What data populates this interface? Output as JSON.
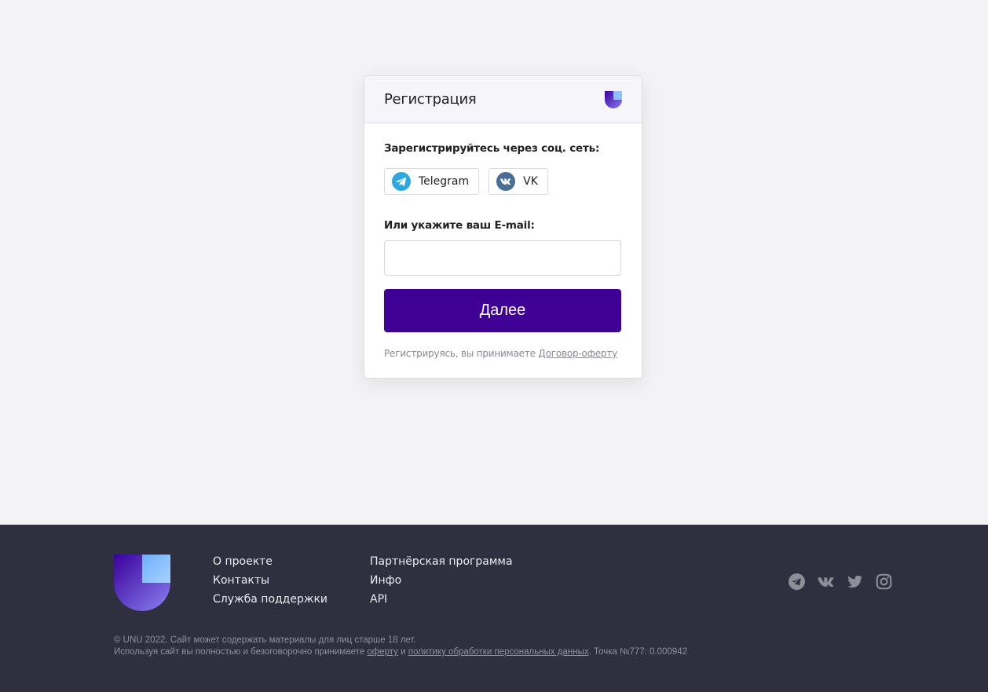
{
  "card": {
    "title": "Регистрация",
    "logo_icon": "unu-logo-icon",
    "social_label": "Зарегистрируйтесь через соц. сеть:",
    "telegram_label": "Telegram",
    "vk_label": "VK",
    "email_label": "Или укажите ваш E-mail:",
    "email_value": "",
    "email_placeholder": "",
    "submit_label": "Далее",
    "terms_text": "Регистрируясь, вы принимаете ",
    "terms_link": "Договор-оферту"
  },
  "footer": {
    "links_col1": [
      "О проекте",
      "Контакты",
      "Служба поддержки"
    ],
    "links_col2": [
      "Партнёрская программа",
      "Инфо",
      "API"
    ],
    "social_icons": [
      "telegram-icon",
      "vk-icon",
      "twitter-icon",
      "instagram-icon"
    ],
    "legal_line1": "© UNU 2022. Сайт может содержать материалы для лиц старше 18 лет.",
    "legal_line2_pre": "Используя сайт вы полностью и безоговорочно принимаете ",
    "legal_offer_link": "оферту",
    "legal_and": " и ",
    "legal_policy_link": "политику обработки персональных данных",
    "legal_point": ". Точка №777: 0.000942"
  },
  "colors": {
    "accent": "#3f0096",
    "footer_bg": "#302f40",
    "page_bg": "#f3f3f6"
  }
}
